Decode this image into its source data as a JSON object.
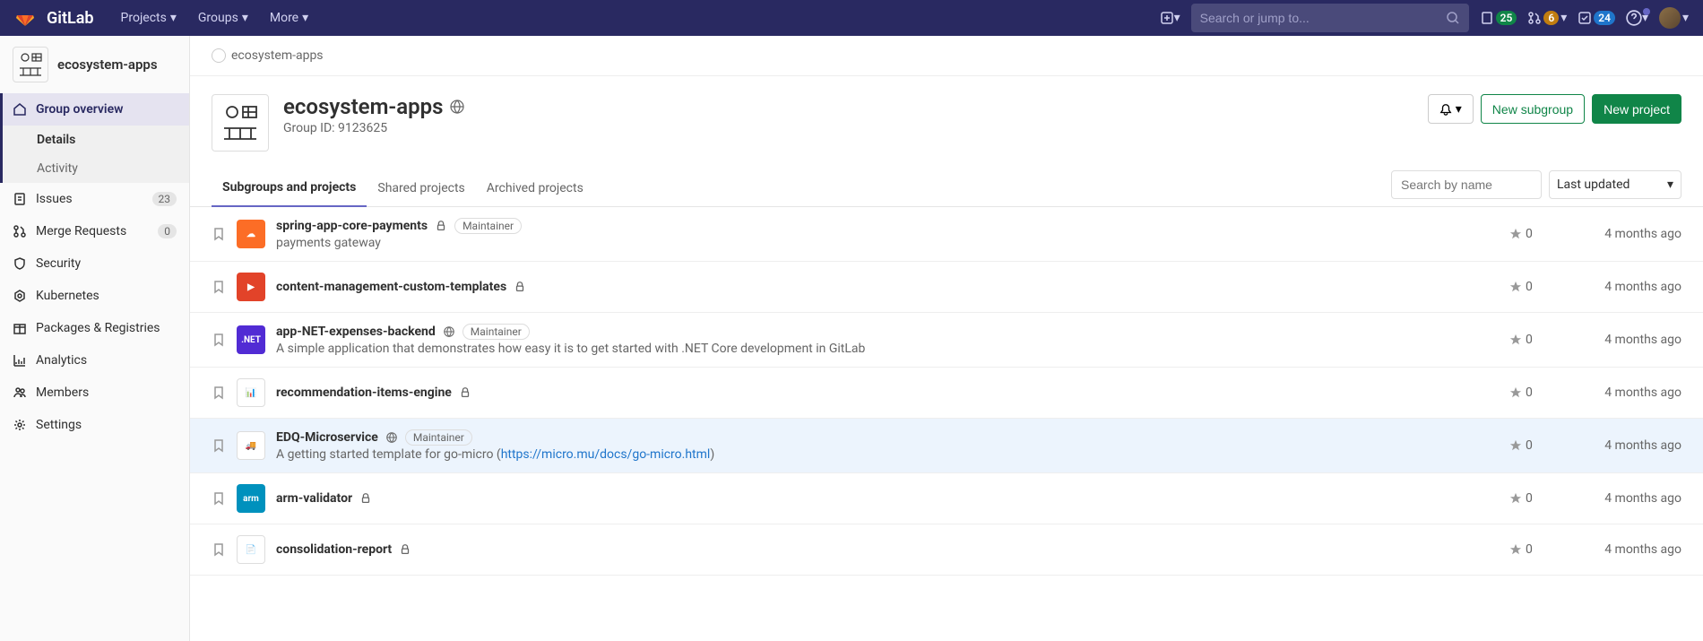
{
  "topnav": {
    "brand": "GitLab",
    "items": [
      "Projects",
      "Groups",
      "More"
    ],
    "search_placeholder": "Search or jump to...",
    "badges": {
      "todos": "25",
      "mrs": "6",
      "issues": "24"
    }
  },
  "sidebar": {
    "group_name": "ecosystem-apps",
    "items": [
      {
        "label": "Group overview",
        "icon": "home",
        "active": true
      },
      {
        "label": "Details",
        "sub": true,
        "active": true
      },
      {
        "label": "Activity",
        "sub": true
      },
      {
        "label": "Issues",
        "icon": "issues",
        "badge": "23"
      },
      {
        "label": "Merge Requests",
        "icon": "mr",
        "badge": "0"
      },
      {
        "label": "Security",
        "icon": "shield"
      },
      {
        "label": "Kubernetes",
        "icon": "kube"
      },
      {
        "label": "Packages & Registries",
        "icon": "package"
      },
      {
        "label": "Analytics",
        "icon": "analytics"
      },
      {
        "label": "Members",
        "icon": "members"
      },
      {
        "label": "Settings",
        "icon": "settings"
      }
    ]
  },
  "breadcrumb": {
    "text": "ecosystem-apps"
  },
  "group": {
    "name": "ecosystem-apps",
    "id_label": "Group ID: 9123625",
    "new_subgroup": "New subgroup",
    "new_project": "New project"
  },
  "tabs": {
    "items": [
      "Subgroups and projects",
      "Shared projects",
      "Archived projects"
    ],
    "search_placeholder": "Search by name",
    "sort_label": "Last updated"
  },
  "projects": [
    {
      "name": "spring-app-core-payments",
      "visibility": "private",
      "role": "Maintainer",
      "desc": "payments gateway",
      "stars": "0",
      "time": "4 months ago",
      "avatar_bg": "#fc6d26",
      "avatar_text": "☁"
    },
    {
      "name": "content-management-custom-templates",
      "visibility": "private",
      "stars": "0",
      "time": "4 months ago",
      "avatar_bg": "#e24329",
      "avatar_text": "▶"
    },
    {
      "name": "app-NET-expenses-backend",
      "visibility": "public",
      "role": "Maintainer",
      "desc": "A simple application that demonstrates how easy it is to get started with .NET Core development in GitLab",
      "stars": "0",
      "time": "4 months ago",
      "avatar_bg": "#512bd4",
      "avatar_text": ".NET"
    },
    {
      "name": "recommendation-items-engine",
      "visibility": "private",
      "stars": "0",
      "time": "4 months ago",
      "avatar_bg": "#fff",
      "avatar_text": "📊",
      "avatar_border": true
    },
    {
      "name": "EDQ-Microservice",
      "visibility": "public",
      "role": "Maintainer",
      "desc_prefix": "A getting started template for go-micro (",
      "desc_link": "https://micro.mu/docs/go-micro.html",
      "desc_suffix": ")",
      "stars": "0",
      "time": "4 months ago",
      "avatar_bg": "#fff",
      "avatar_text": "🚚",
      "avatar_border": true,
      "highlight": true
    },
    {
      "name": "arm-validator",
      "visibility": "private",
      "stars": "0",
      "time": "4 months ago",
      "avatar_bg": "#0091bd",
      "avatar_text": "arm"
    },
    {
      "name": "consolidation-report",
      "visibility": "private",
      "stars": "0",
      "time": "4 months ago",
      "avatar_bg": "#fff",
      "avatar_text": "📄",
      "avatar_border": true
    }
  ]
}
